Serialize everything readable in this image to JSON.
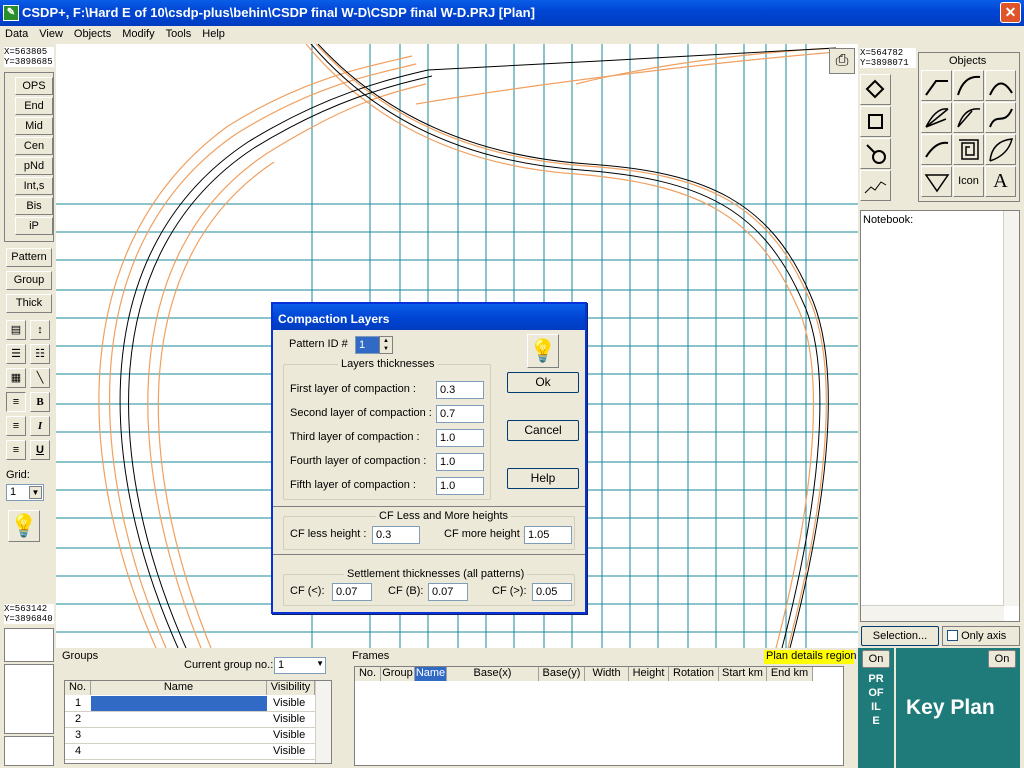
{
  "title": "CSDP+, F:\\Hard E of 10\\csdp-plus\\behin\\CSDP final W-D\\CSDP final W-D.PRJ [Plan]",
  "menu": [
    "Data",
    "View",
    "Objects",
    "Modify",
    "Tools",
    "Help"
  ],
  "coords": {
    "top_left": {
      "x": "X=563805",
      "y": "Y=3898685"
    },
    "top_right": {
      "x": "X=564782",
      "y": "Y=3898071"
    },
    "bottom_left": {
      "x": "X=563142",
      "y": "Y=3896840"
    }
  },
  "snap_buttons": [
    "OPS",
    "End",
    "Mid",
    "Cen",
    "pNd",
    "Int,s",
    "Bis",
    "iP"
  ],
  "tool_buttons": [
    "Pattern",
    "Group",
    "Thick"
  ],
  "format_icons": [
    "B",
    "I",
    "U"
  ],
  "grid": {
    "label": "Grid:",
    "value": "1"
  },
  "objects_panel": {
    "title": "Objects",
    "icon_label": "Icon",
    "text_label": "A"
  },
  "notebook": {
    "label": "Notebook:"
  },
  "selection": {
    "button": "Selection...",
    "only_axis": "Only axis"
  },
  "groups": {
    "title": "Groups",
    "current_label": "Current group no.:",
    "current_value": "1",
    "columns": [
      "No.",
      "Name",
      "Visibility"
    ],
    "rows": [
      {
        "no": "1",
        "name": "",
        "vis": "Visible"
      },
      {
        "no": "2",
        "name": "",
        "vis": "Visible"
      },
      {
        "no": "3",
        "name": "",
        "vis": "Visible"
      },
      {
        "no": "4",
        "name": "",
        "vis": "Visible"
      }
    ]
  },
  "frames": {
    "title": "Frames",
    "region_label": "Plan details region",
    "columns": [
      "No.",
      "Group",
      "Name",
      "Base(x)",
      "Base(y)",
      "Width",
      "Height",
      "Rotation",
      "Start km",
      "End km"
    ]
  },
  "profile": {
    "on": "On",
    "label": "PROFILE"
  },
  "keyplan": {
    "on": "On",
    "label": "Key Plan"
  },
  "dialog": {
    "title": "Compaction Layers",
    "pattern_label": "Pattern ID #",
    "pattern_value": "1",
    "layers_group": "Layers thicknesses",
    "layers": [
      {
        "label": "First layer of compaction :",
        "value": "0.3"
      },
      {
        "label": "Second layer of compaction :",
        "value": "0.7"
      },
      {
        "label": "Third layer of compaction :",
        "value": "1.0"
      },
      {
        "label": "Fourth layer of compaction :",
        "value": "1.0"
      },
      {
        "label": "Fifth layer of compaction :",
        "value": "1.0"
      }
    ],
    "ok": "Ok",
    "cancel": "Cancel",
    "help": "Help",
    "cf_group": "CF Less and More heights",
    "cf_less_label": "CF less height :",
    "cf_less_value": "0.3",
    "cf_more_label": "CF more height :",
    "cf_more_value": "1.05",
    "settle_group": "Settlement thicknesses (all patterns)",
    "cf_lt_label": "CF (<):",
    "cf_lt_value": "0.07",
    "cf_b_label": "CF (B):",
    "cf_b_value": "0.07",
    "cf_gt_label": "CF (>):",
    "cf_gt_value": "0.05"
  },
  "colors": {
    "grid": "#1a8a9a",
    "road": "#000000",
    "contour": "#f0a060",
    "teal": "#1f7a7a"
  }
}
